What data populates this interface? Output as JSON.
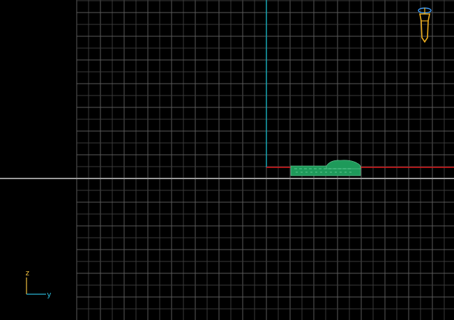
{
  "viewport": {
    "background": "#000000",
    "grid_minor_color": "#3a3a3a",
    "grid_major_color": "#5a5a5a",
    "horizon_color": "#9a9a9a",
    "z_axis_color": "#17a7b5",
    "x_axis_color": "#e0191b",
    "object_color": "#1e9a5a",
    "object_highlight_color": "#6fd3a0"
  },
  "axis_gizmo": {
    "vertical_label": "z",
    "horizontal_label": "y",
    "color": "#f0c040",
    "label_color_horizontal": "#2ab7d6"
  },
  "view_cube": {
    "icon": "camera-gizmo-icon",
    "color": "#f0b020",
    "ring_color": "#40a0ff"
  }
}
